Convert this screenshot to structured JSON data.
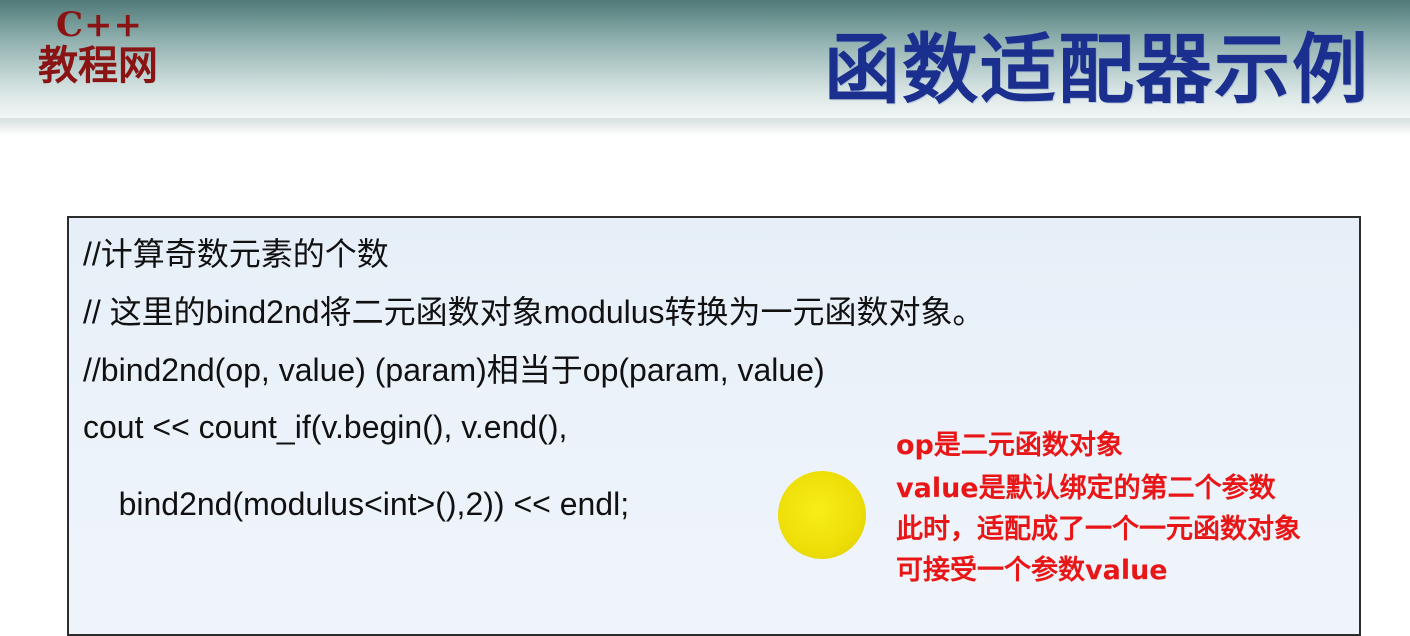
{
  "logo": {
    "line1": "C++",
    "line2": "教程网"
  },
  "title": "函数适配器示例",
  "code": {
    "lines": [
      "//计算奇数元素的个数",
      "// 这里的bind2nd将二元函数对象modulus转换为一元函数对象。",
      "//bind2nd(op, value) (param)相当于op(param, value)",
      "cout << count_if(v.begin(), v.end(),",
      "    bind2nd(modulus<int>(),2)) << endl;"
    ]
  },
  "annotation": {
    "lines": [
      "op是二元函数对象",
      "value是默认绑定的第二个参数",
      "此时，适配成了一个一元函数对象",
      "可接受一个参数value"
    ]
  },
  "colors": {
    "title": "#1a2f8e",
    "logo": "#8a1414",
    "annotation": "#e81616",
    "highlight_dot": "#eede08",
    "code_box_bg": "#e6eff8"
  }
}
